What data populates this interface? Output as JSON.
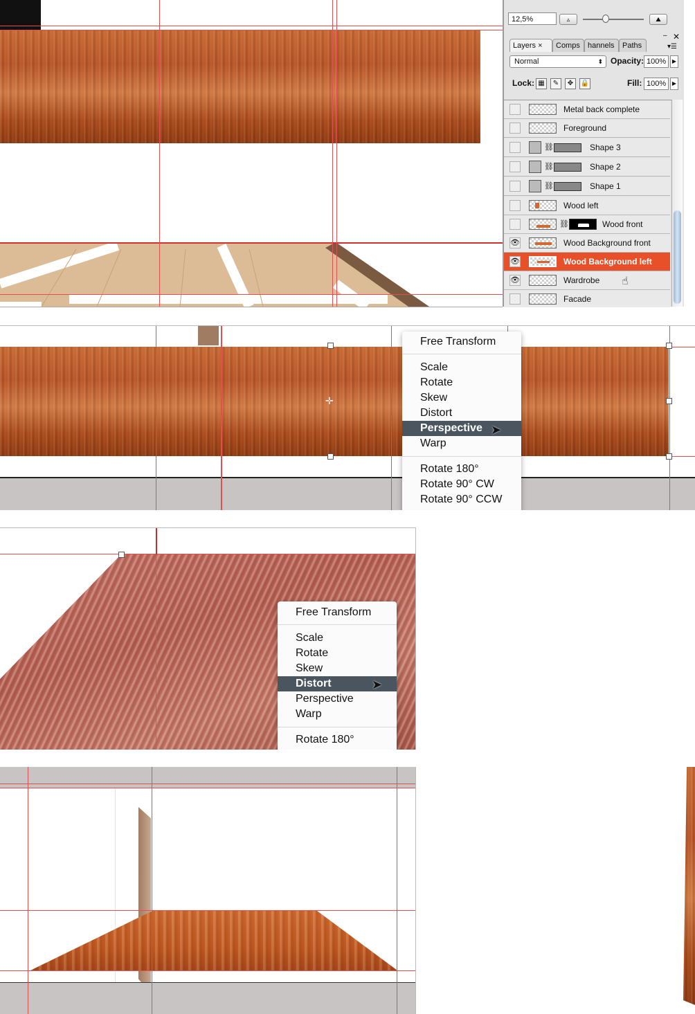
{
  "layers_panel": {
    "zoom": "12,5%",
    "tabs": [
      "Layers",
      "Comps",
      "hannels",
      "Paths"
    ],
    "tab_close": "×",
    "blend_mode": "Normal",
    "opacity_label": "Opacity:",
    "opacity_value": "100%",
    "lock_label": "Lock:",
    "fill_label": "Fill:",
    "fill_value": "100%",
    "layers": [
      {
        "name": "Metal back complete",
        "visible": false,
        "selected": false
      },
      {
        "name": "Foreground",
        "visible": false,
        "selected": false
      },
      {
        "name": "Shape 3",
        "visible": false,
        "selected": false
      },
      {
        "name": "Shape 2",
        "visible": false,
        "selected": false
      },
      {
        "name": "Shape 1",
        "visible": false,
        "selected": false
      },
      {
        "name": "Wood left",
        "visible": false,
        "selected": false
      },
      {
        "name": "Wood front",
        "visible": false,
        "selected": false
      },
      {
        "name": "Wood Background front",
        "visible": true,
        "selected": false
      },
      {
        "name": "Wood Background left",
        "visible": true,
        "selected": true
      },
      {
        "name": "Wardrobe",
        "visible": true,
        "selected": false
      },
      {
        "name": "Facade",
        "visible": false,
        "selected": false
      }
    ]
  },
  "menu_perspective": {
    "title": "Free Transform",
    "items": [
      "Scale",
      "Rotate",
      "Skew",
      "Distort",
      "Perspective",
      "Warp"
    ],
    "highlighted": "Perspective",
    "rotate_items": [
      "Rotate 180°",
      "Rotate 90° CW",
      "Rotate 90° CCW"
    ]
  },
  "menu_distort": {
    "title": "Free Transform",
    "items": [
      "Scale",
      "Rotate",
      "Skew",
      "Distort",
      "Perspective",
      "Warp"
    ],
    "highlighted": "Distort",
    "rotate_items": [
      "Rotate 180°"
    ]
  },
  "colors": {
    "guide": "#e05050",
    "selected_layer": "#e8502a",
    "menu_highlight": "#4a5560",
    "floor_beige": "#dcbc96"
  }
}
